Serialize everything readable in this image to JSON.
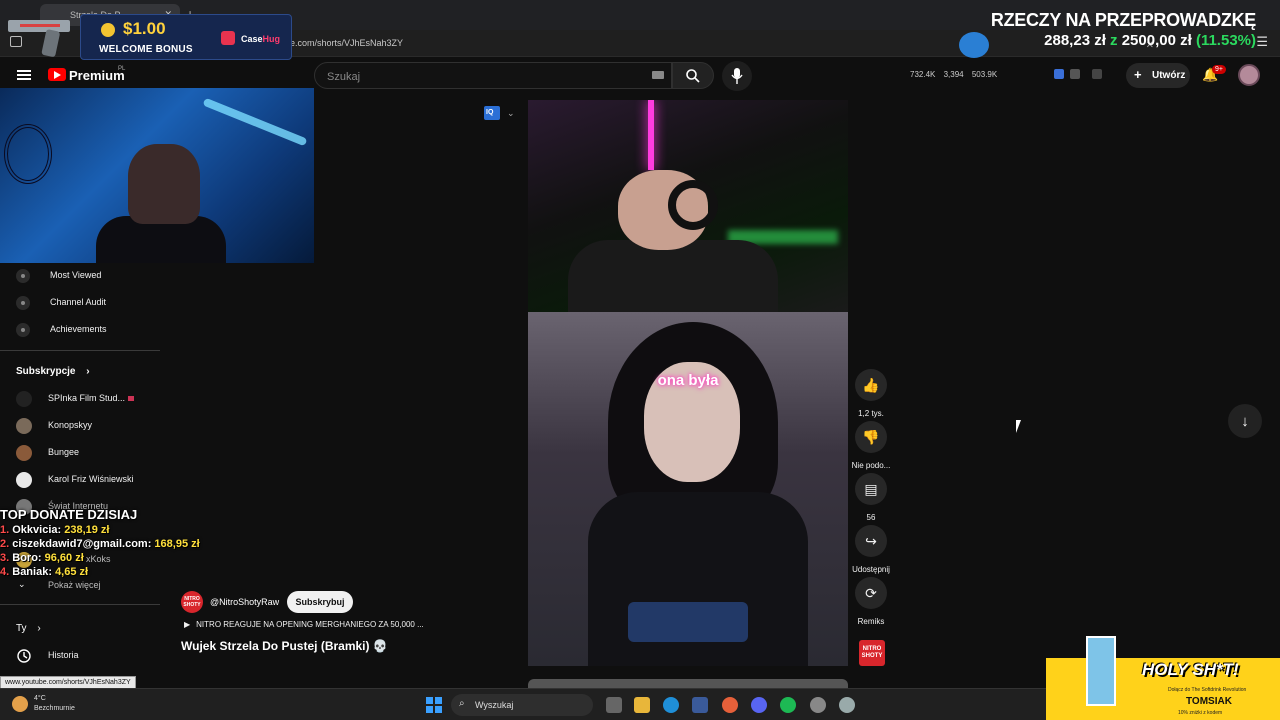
{
  "browser": {
    "tab_title": "Strzela Do P...",
    "url": "e.com/shorts/VJhEsNah3ZY",
    "status_url": "www.youtube.com/shorts/VJhEsNah3ZY"
  },
  "casino_overlay": {
    "amount": "$1.00",
    "label": "WELCOME BONUS",
    "brand_a": "Case",
    "brand_b": "Hug"
  },
  "goal_overlay": {
    "title": "RZECZY NA PRZEPROWADZKĘ",
    "current": "288,23 zł",
    "sep": "z",
    "target": "2500,00 zł",
    "percent": "(11.53%)"
  },
  "header": {
    "logo_text": "Premium",
    "region": "PL",
    "search_placeholder": "Szukaj",
    "stats": {
      "subs": "732.4K",
      "views_a": "3,394",
      "views_b": "503.9K"
    },
    "create_label": "Utwórz",
    "bell_badge": "9+"
  },
  "sidebar": {
    "studio_items": [
      {
        "label": "Most Viewed"
      },
      {
        "label": "Channel Audit"
      },
      {
        "label": "Achievements"
      }
    ],
    "subs_heading": "Subskrypcje",
    "subscriptions": [
      {
        "label": "SPInka Film Stud..."
      },
      {
        "label": "Konopskyy"
      },
      {
        "label": "Bungee"
      },
      {
        "label": "Karol Friz Wiśniewski"
      },
      {
        "label": "Świat Internetu"
      },
      {
        "label": "xKoks"
      }
    ],
    "show_more": "Pokaż więcej",
    "you_heading": "Ty",
    "history": "Historia"
  },
  "donate_overlay": {
    "title": "TOP DONATE DZISIAJ",
    "rows": [
      {
        "n": "1.",
        "name": "Okkvicia:",
        "amount": "238,19 zł"
      },
      {
        "n": "2.",
        "name": "ciszekdawid7@gmail.com:",
        "amount": "168,95 zł"
      },
      {
        "n": "3.",
        "name": "Boro:",
        "amount": "96,60 zł"
      },
      {
        "n": "4.",
        "name": "Baniak:",
        "amount": "4,65 zł"
      }
    ]
  },
  "video": {
    "caption": "ona była",
    "channel_handle": "@NitroShotyRaw",
    "channel_avatar_text": "NITRO SHOTY",
    "subscribe": "Subskrybuj",
    "playlist": "NITRO REAGUJE NA OPENING MERGHANIEGO ZA 50,000 ...",
    "title": "Wujek Strzela Do Pustej (Bramki) 💀"
  },
  "actions": {
    "likes": "1,2 tys.",
    "dislike": "Nie podo...",
    "comments": "56",
    "share": "Udostępnij",
    "remix": "Remiks"
  },
  "taskbar": {
    "temp": "4°C",
    "weather": "Bezchmurnie",
    "search": "Wyszukaj"
  },
  "promo": {
    "headline": "HOLY SH*T!",
    "small": "Dołącz do The Softdrink Revolution",
    "name": "TOMSIAK",
    "code": "10% zniżki z kodem"
  }
}
